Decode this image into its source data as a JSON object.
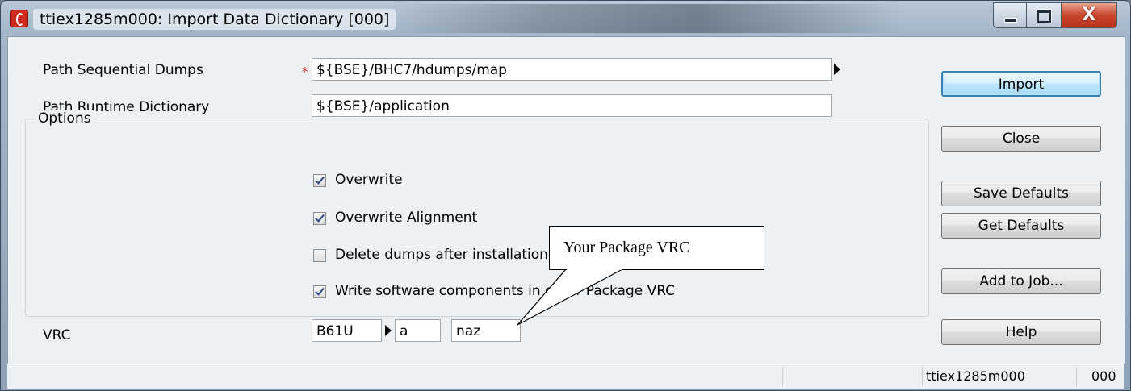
{
  "window": {
    "title": "ttiex1285m000: Import Data Dictionary [000]",
    "minimize_icon": "minimize-icon",
    "maximize_icon": "maximize-icon",
    "close_label": "X"
  },
  "form": {
    "path_seq_label": "Path Sequential Dumps",
    "path_seq_required": "*",
    "path_seq_value": "${BSE}/BHC7/hdumps/map",
    "path_runtime_label": "Path Runtime Dictionary",
    "path_runtime_value": "${BSE}/application",
    "options_legend": "Options",
    "options": [
      {
        "label": "Overwrite",
        "checked": true
      },
      {
        "label": "Overwrite Alignment",
        "checked": true
      },
      {
        "label": "Delete dumps after installation",
        "checked": false
      },
      {
        "label": "Write software components in other Package VRC",
        "checked": true
      }
    ],
    "vrc_label": "VRC",
    "vrc_version": "B61U",
    "vrc_release": "a",
    "vrc_customer": "naz"
  },
  "buttons": {
    "import": "Import",
    "close": "Close",
    "save_defaults": "Save Defaults",
    "get_defaults": "Get Defaults",
    "add_to_job": "Add to Job...",
    "help": "Help"
  },
  "statusbar": {
    "session": "ttiex1285m000",
    "company": "000"
  },
  "annotation": {
    "callout_text": "Your Package VRC"
  }
}
